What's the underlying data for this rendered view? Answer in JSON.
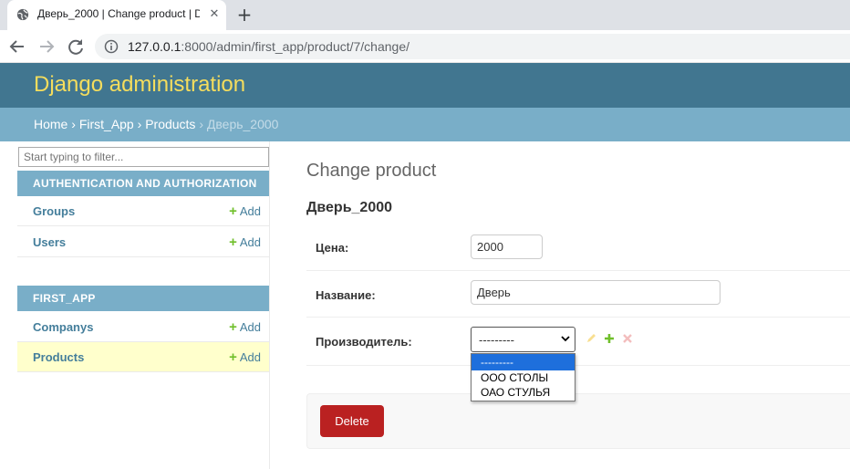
{
  "browser": {
    "tab_title": "Дверь_2000 | Change product | D",
    "url_host": "127.0.0.1",
    "url_rest": ":8000/admin/first_app/product/7/change/"
  },
  "header": {
    "branding": "Django administration"
  },
  "breadcrumbs": {
    "items": [
      "Home",
      "First_App",
      "Products"
    ],
    "current": "Дверь_2000",
    "separator": "›"
  },
  "sidebar": {
    "filter_placeholder": "Start typing to filter...",
    "add_label": "Add",
    "modules": [
      {
        "caption": "AUTHENTICATION AND AUTHORIZATION",
        "models": [
          "Groups",
          "Users"
        ]
      },
      {
        "caption": "FIRST_APP",
        "models": [
          "Companys",
          "Products"
        ]
      }
    ]
  },
  "content": {
    "title": "Change product",
    "object_title": "Дверь_2000",
    "fields": {
      "price": {
        "label": "Цена:",
        "value": "2000"
      },
      "name": {
        "label": "Название:",
        "value": "Дверь"
      },
      "maker": {
        "label": "Производитель:",
        "value": "---------"
      }
    },
    "maker_options": [
      "---------",
      "ООО СТОЛЫ",
      "ОАО СТУЛЬЯ"
    ],
    "delete_label": "Delete"
  },
  "colors": {
    "header_bg": "#417690",
    "branding": "#f5dd5d",
    "breadcrumbs_bg": "#79aec8",
    "link": "#447e9b",
    "add_green": "#70bf2b",
    "delete_red": "#ba2121",
    "current_row": "#ffffcc"
  }
}
